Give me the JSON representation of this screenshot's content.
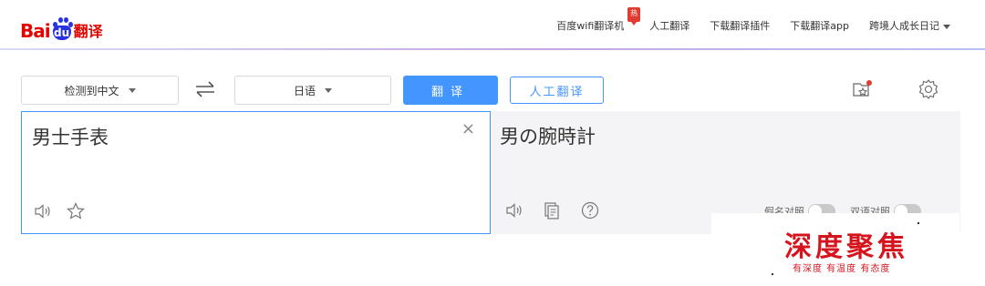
{
  "header": {
    "logo": {
      "bai": "Bai",
      "du": "du",
      "product": "翻译"
    },
    "nav": [
      {
        "label": "百度wifi翻译机",
        "badge": "热"
      },
      {
        "label": "人工翻译"
      },
      {
        "label": "下载翻译插件"
      },
      {
        "label": "下载翻译app"
      },
      {
        "label": "跨境人成长日记"
      }
    ]
  },
  "toolbar": {
    "source_lang": "检测到中文",
    "target_lang": "日语",
    "translate_label": "翻译",
    "human_translate_label": "人工翻译",
    "icons": [
      "swap-icon",
      "favorites-folder-icon",
      "settings-gear-icon"
    ]
  },
  "source": {
    "text": "男士手表",
    "clear_glyph": "×",
    "icons": [
      "speaker-icon",
      "star-icon"
    ]
  },
  "result": {
    "text": "男の腕時計",
    "icons": [
      "speaker-icon",
      "copy-icon",
      "help-icon"
    ],
    "toggles": [
      {
        "label": "假名对照",
        "on": false
      },
      {
        "label": "双语对照",
        "on": false
      }
    ]
  },
  "watermark": {
    "title": "深度聚焦",
    "subtitle": "有深度 有温度 有态度"
  },
  "colors": {
    "accent": "#4395ff",
    "logo_red": "#e10602",
    "logo_blue": "#2932e1",
    "watermark_red": "#d6141e"
  }
}
